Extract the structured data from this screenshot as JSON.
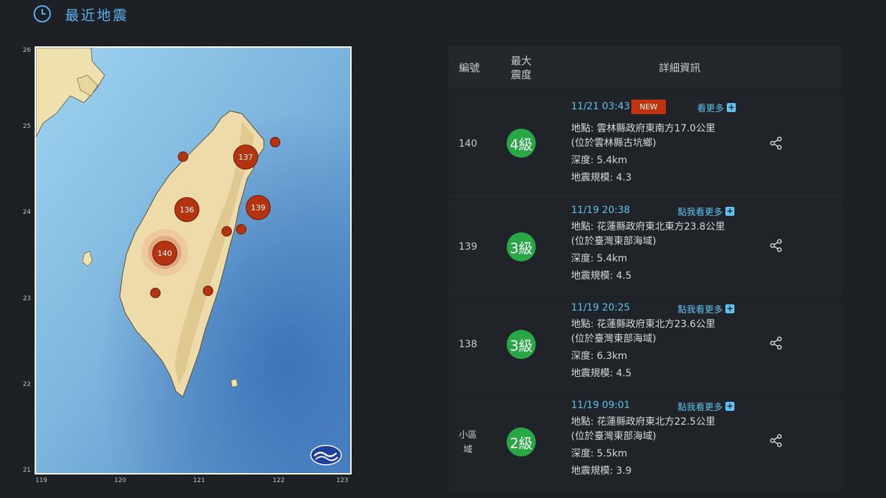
{
  "header": {
    "title": "最近地震"
  },
  "map": {
    "y_ticks": [
      "26",
      "25",
      "24",
      "23",
      "22",
      "21"
    ],
    "x_ticks": [
      "119",
      "120",
      "121",
      "122",
      "123"
    ],
    "markers": [
      "137",
      "136",
      "139",
      "140"
    ]
  },
  "table": {
    "col_id": "編號",
    "col_intensity_line1": "最大",
    "col_intensity_line2": "震度",
    "col_detail": "詳細資訊"
  },
  "quakes": [
    {
      "id": "140",
      "intensity": "4級",
      "time": "11/21 03:43",
      "new_label": "NEW",
      "more": "看更多",
      "location": "地點: 雲林縣政府東南方17.0公里",
      "location_note": "(位於雲林縣古坑鄉)",
      "depth": "深度: 5.4km",
      "magnitude": "地震規模: 4.3"
    },
    {
      "id": "139",
      "intensity": "3級",
      "time": "11/19 20:38",
      "more": "點我看更多",
      "location": "地點: 花蓮縣政府東北東方23.8公里",
      "location_note": "(位於臺灣東部海域)",
      "depth": "深度: 5.4km",
      "magnitude": "地震規模: 4.5"
    },
    {
      "id": "138",
      "intensity": "3級",
      "time": "11/19 20:25",
      "more": "點我看更多",
      "location": "地點: 花蓮縣政府東北方23.6公里",
      "location_note": "(位於臺灣東部海域)",
      "depth": "深度: 6.3km",
      "magnitude": "地震規模: 4.5"
    },
    {
      "id_line1": "小區",
      "id_line2": "域",
      "intensity": "2級",
      "time": "11/19 09:01",
      "more": "點我看更多",
      "location": "地點: 花蓮縣政府東北方22.5公里",
      "location_note": "(位於臺灣東部海域)",
      "depth": "深度: 5.5km",
      "magnitude": "地震規模: 3.9"
    }
  ],
  "colors": {
    "accent": "#5fc3f1",
    "intensity_badge": "#27a844",
    "new_tag": "#c0330f",
    "marker": "#b4340f"
  }
}
